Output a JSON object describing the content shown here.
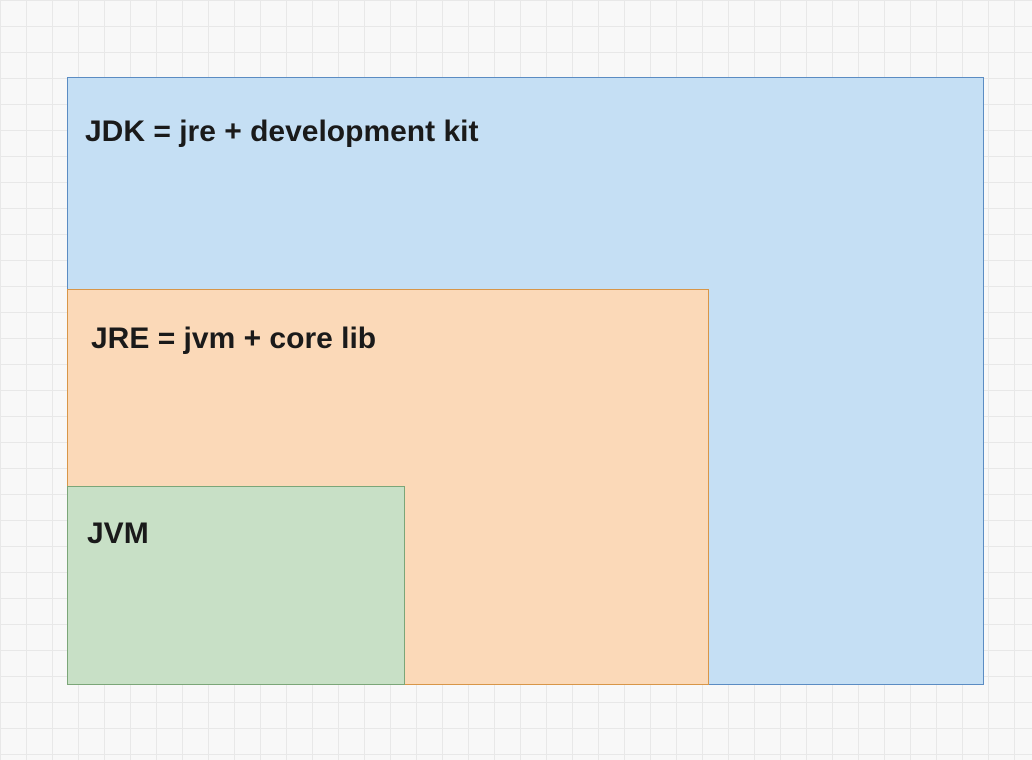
{
  "diagram": {
    "jdk": {
      "label": "JDK = jre + development kit",
      "color": "#c5dff4",
      "border": "#5b8cc3"
    },
    "jre": {
      "label": "JRE = jvm + core lib",
      "color": "#fbd9b8",
      "border": "#d89648"
    },
    "jvm": {
      "label": "JVM",
      "color": "#c8e0c6",
      "border": "#7ba678"
    }
  }
}
